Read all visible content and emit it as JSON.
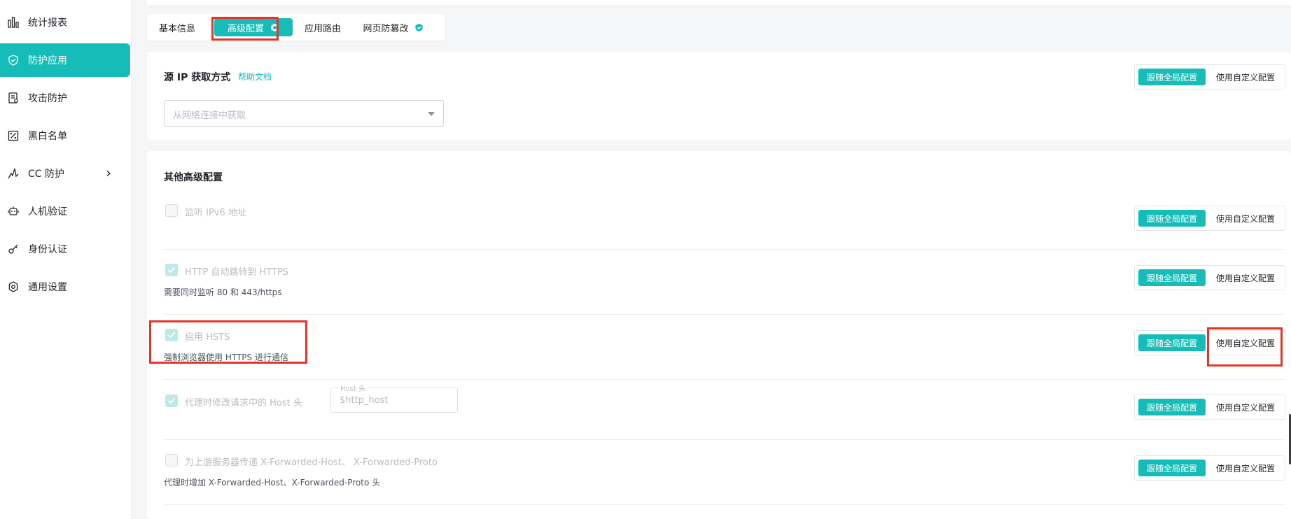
{
  "sidebar": {
    "items": [
      {
        "label": "统计报表",
        "icon": "bar-chart-icon"
      },
      {
        "label": "防护应用",
        "icon": "shield-icon",
        "active": true
      },
      {
        "label": "攻击防护",
        "icon": "document-icon"
      },
      {
        "label": "黑白名单",
        "icon": "list-percent-icon"
      },
      {
        "label": "CC 防护",
        "icon": "chart-spike-icon",
        "has_submenu": true
      },
      {
        "label": "人机验证",
        "icon": "robot-icon"
      },
      {
        "label": "身份认证",
        "icon": "key-icon"
      },
      {
        "label": "通用设置",
        "icon": "gear-icon"
      }
    ]
  },
  "tabs": [
    {
      "label": "基本信息"
    },
    {
      "label": "高级配置",
      "active": true,
      "icon": "cube-badge-icon"
    },
    {
      "label": "应用路由"
    },
    {
      "label": "网页防篡改",
      "icon": "shield-badge-icon"
    }
  ],
  "source_ip": {
    "title": "源 IP 获取方式",
    "help_link": "帮助文档",
    "select_placeholder": "从网络连接中获取"
  },
  "toggle": {
    "follow_label": "跟随全局配置",
    "custom_label": "使用自定义配置"
  },
  "other": {
    "title": "其他高级配置",
    "options": [
      {
        "label": "监听 IPv6 地址",
        "checked": false,
        "desc": ""
      },
      {
        "label": "HTTP 自动跳转到 HTTPS",
        "checked": true,
        "desc": "需要同时监听 80 和 443/https"
      },
      {
        "label": "启用 HSTS",
        "checked": true,
        "desc": "强制浏览器使用 HTTPS 进行通信"
      },
      {
        "label": "代理时修改请求中的 Host 头",
        "checked": true,
        "desc": "",
        "field_legend": "Host 头",
        "field_value": "$http_host"
      },
      {
        "label": "为上游服务器传递 X-Forwarded-Host、 X-Forwarded-Proto",
        "checked": false,
        "desc": "代理时增加 X-Forwarded-Host、X-Forwarded-Proto 头"
      }
    ]
  },
  "colors": {
    "accent": "#16bdb8",
    "highlight": "#e6332a"
  }
}
